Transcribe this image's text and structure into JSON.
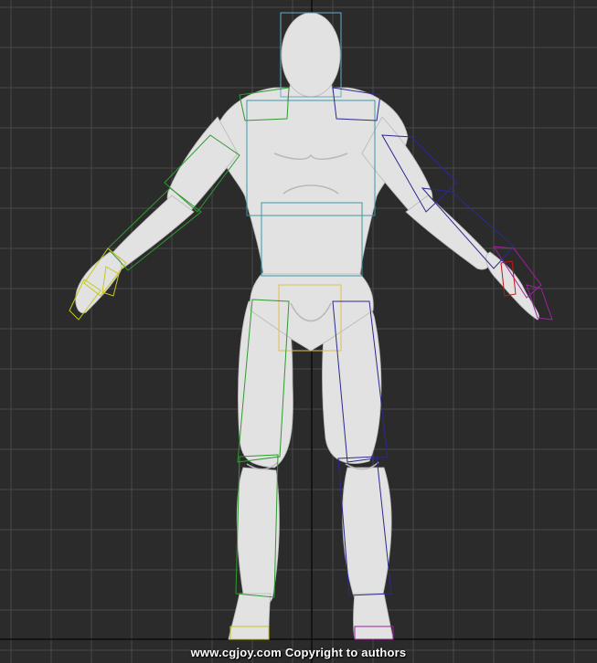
{
  "viewport": {
    "background": "#2b2b2b",
    "grid_color": "#4a4a4a",
    "axis_color": "#0d0d0d"
  },
  "model": {
    "skin_color": "#e2e2e2",
    "shade_color": "#b9b9b9",
    "bone_colors": {
      "head": "#5fb0c8",
      "torso": "#3d96a6",
      "pelvis": "#e0c050",
      "left_arm": "#2f9a2f",
      "right_arm": "#2a2a90",
      "left_leg": "#2f9a2f",
      "right_leg": "#2a2a90",
      "left_fingers": "#c8c820",
      "right_fingers": "#a020a0",
      "right_thumb": "#c01818",
      "left_foot": "#c8c820",
      "right_foot": "#a020a0"
    }
  },
  "watermark": {
    "text": "www.cgjoy.com Copyright to authors"
  }
}
